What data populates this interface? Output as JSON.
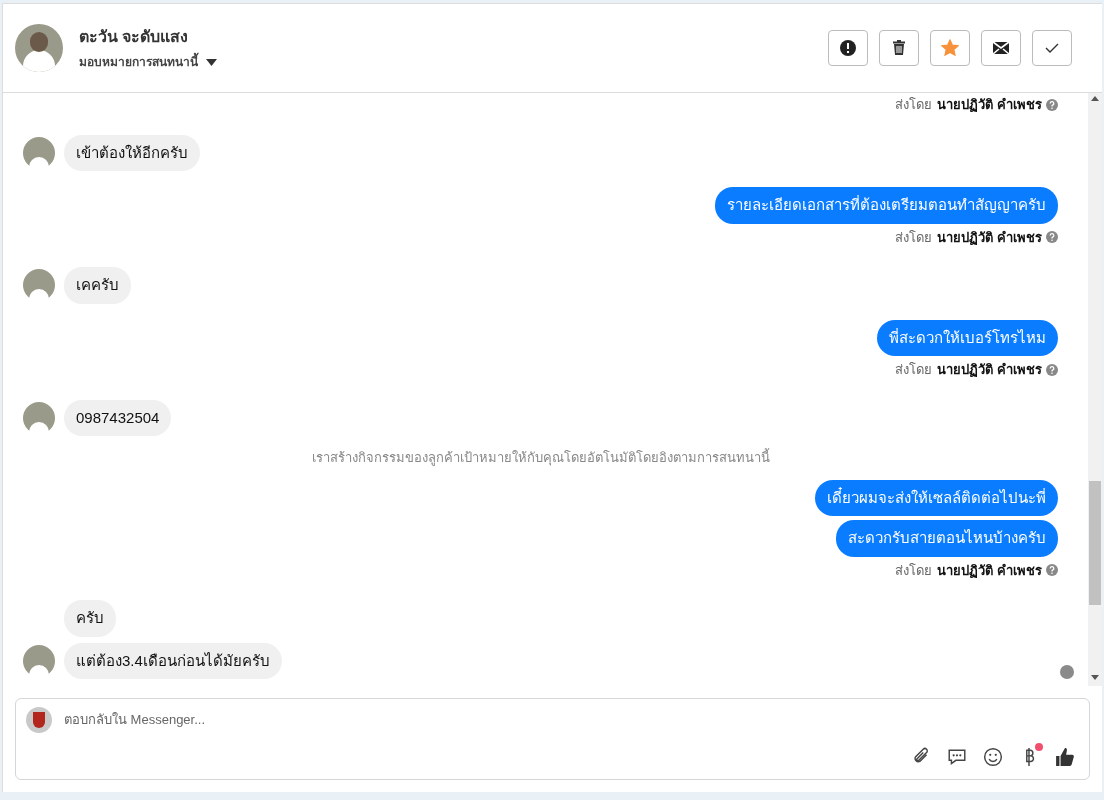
{
  "header": {
    "name": "ตะวัน จะดับแสง",
    "assign_label": "มอบหมายการสนทนานี้",
    "actions": [
      {
        "kind": "alert"
      },
      {
        "kind": "trash"
      },
      {
        "kind": "star",
        "on": true
      },
      {
        "kind": "mail"
      },
      {
        "kind": "check"
      }
    ]
  },
  "messages": [
    {
      "kind": "sent_by",
      "label": "ส่งโดย",
      "name": "นายปฏิวัติ คำเพชร"
    },
    {
      "kind": "incoming",
      "text": "เข้าต้องให้อีกครับ",
      "avatar": true
    },
    {
      "kind": "outgoing",
      "text": "รายละเอียดเอกสารที่ต้องเตรียมตอนทำสัญญาครับ"
    },
    {
      "kind": "sent_by",
      "label": "ส่งโดย",
      "name": "นายปฏิวัติ คำเพชร"
    },
    {
      "kind": "incoming",
      "text": "เคครับ",
      "avatar": true
    },
    {
      "kind": "outgoing",
      "text": "พี่สะดวกให้เบอร์โทรไหม"
    },
    {
      "kind": "sent_by",
      "label": "ส่งโดย",
      "name": "นายปฏิวัติ คำเพชร"
    },
    {
      "kind": "incoming",
      "text": "0987432504",
      "avatar": true
    },
    {
      "kind": "system",
      "text": "เราสร้างกิจกรรมของลูกค้าเป้าหมายให้กับคุณโดยอัตโนมัติโดยอิงตามการสนทนานี้"
    },
    {
      "kind": "outgoing",
      "text": "เดี๋ยวผมจะส่งให้เซลล์ติดต่อไปนะพี่"
    },
    {
      "kind": "outgoing",
      "text": "สะดวกรับสายตอนไหนบ้างครับ"
    },
    {
      "kind": "sent_by",
      "label": "ส่งโดย",
      "name": "นายปฏิวัติ คำเพชร"
    },
    {
      "kind": "incoming",
      "text": "ครับ",
      "avatar": false
    },
    {
      "kind": "incoming",
      "text": "แต่ต้อง3.4เดือนก่อนได้มัยครับ",
      "avatar": true,
      "seen": true
    }
  ],
  "composer": {
    "placeholder": "ตอบกลับใน Messenger...",
    "tools": [
      {
        "kind": "clip"
      },
      {
        "kind": "chat"
      },
      {
        "kind": "smile"
      },
      {
        "kind": "baht",
        "badge": true
      },
      {
        "kind": "like"
      }
    ]
  }
}
